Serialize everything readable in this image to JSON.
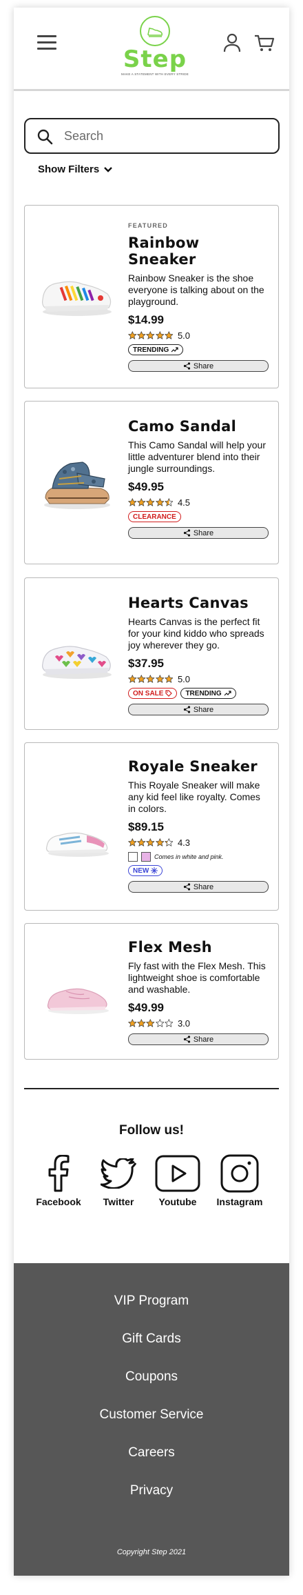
{
  "header": {
    "logo_name": "Step",
    "logo_tagline": "MAKE A STATEMENT WITH EVERY STRIDE"
  },
  "search": {
    "placeholder": "Search",
    "value": ""
  },
  "filters": {
    "label": "Show Filters"
  },
  "products": [
    {
      "featured": "FEATURED",
      "name": "Rainbow Sneaker",
      "description": "Rainbow Sneaker is the shoe everyone is talking about on the playground.",
      "price": "$14.99",
      "rating": 5.0,
      "rating_text": "5.0",
      "badges": [
        "TRENDING"
      ],
      "share": "Share"
    },
    {
      "name": "Camo Sandal",
      "description": "This Camo Sandal will help your little adventurer blend into their jungle surroundings.",
      "price": "$49.95",
      "rating": 4.5,
      "rating_text": "4.5",
      "badges": [
        "CLEARANCE"
      ],
      "share": "Share"
    },
    {
      "name": "Hearts Canvas",
      "description": "Hearts Canvas is the perfect fit for your kind kiddo who spreads joy wherever they go.",
      "price": "$37.95",
      "rating": 5.0,
      "rating_text": "5.0",
      "badges": [
        "ON SALE",
        "TRENDING"
      ],
      "share": "Share"
    },
    {
      "name": "Royale Sneaker",
      "description": "This Royale Sneaker will make any kid feel like royalty. Comes in colors.",
      "price": "$89.15",
      "rating": 4.3,
      "rating_text": "4.3",
      "colors_note": "Comes in white and pink.",
      "color_swatches": [
        "#ffffff",
        "#e8b3e6"
      ],
      "badges": [
        "NEW"
      ],
      "share": "Share"
    },
    {
      "name": "Flex Mesh",
      "description": "Fly fast with the Flex Mesh. This lightweight shoe is comfortable and washable.",
      "price": "$49.99",
      "rating": 3.0,
      "rating_text": "3.0",
      "badges": [],
      "share": "Share"
    }
  ],
  "follow": {
    "title": "Follow us!",
    "networks": [
      "Facebook",
      "Twitter",
      "Youtube",
      "Instagram"
    ]
  },
  "footer": {
    "links": [
      "VIP Program",
      "Gift Cards",
      "Coupons",
      "Customer Service",
      "Careers",
      "Privacy"
    ],
    "copyright": "Copyright Step 2021"
  },
  "colors": {
    "brand_green": "#7ad24a",
    "footer_bg": "#575757",
    "star_fill": "#f0a020",
    "clearance_red": "#d01b1b",
    "new_blue": "#3b45d6"
  }
}
